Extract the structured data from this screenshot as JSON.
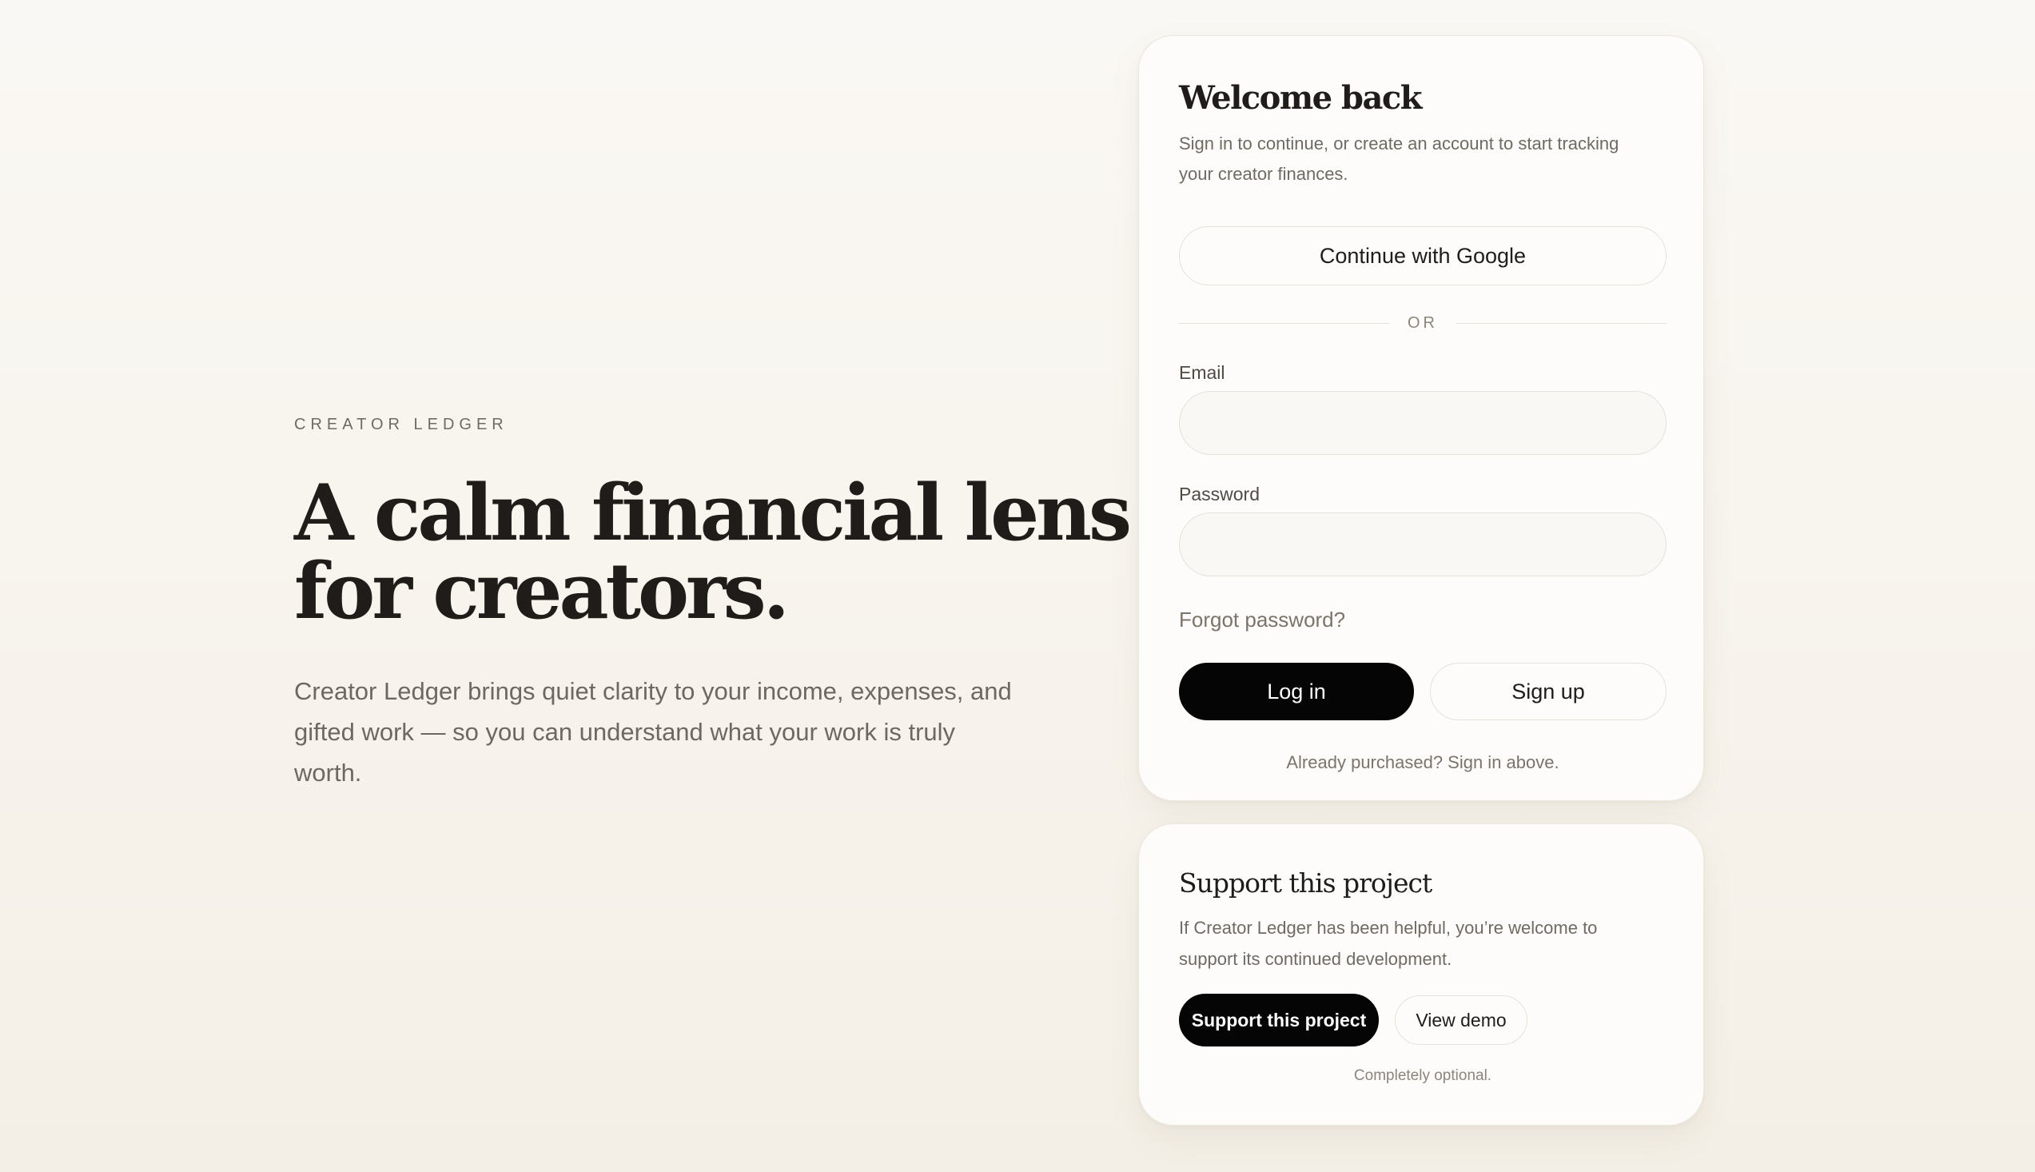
{
  "hero": {
    "eyebrow": "CREATOR LEDGER",
    "headline_line1": "A calm financial lens",
    "headline_line2": "for creators.",
    "description_line1": "Creator Ledger brings quiet clarity to your income, expenses, and",
    "description_line2": "gifted work — so you can understand what your work is truly worth."
  },
  "login": {
    "title": "Welcome back",
    "subtitle": "Sign in to continue, or create an account to start tracking your creator finances.",
    "google_button": "Continue with Google",
    "divider": "OR",
    "email_label": "Email",
    "email_value": "",
    "email_placeholder": "",
    "password_label": "Password",
    "password_value": "",
    "password_placeholder": "",
    "forgot_password": "Forgot password?",
    "login_button": "Log in",
    "signup_button": "Sign up",
    "note": "Already purchased? Sign in above."
  },
  "support": {
    "title": "Support this project",
    "description": "If Creator Ledger has been helpful, you’re welcome to support its continued development.",
    "support_button": "Support this project",
    "demo_button": "View demo",
    "note": "Completely optional."
  },
  "colors": {
    "background": "#faf8f4",
    "card": "#fdfcfa",
    "primary_button": "#050505",
    "text_dark": "#1f1c19",
    "text_muted": "#6f6a62",
    "border": "#e6e1d9"
  }
}
